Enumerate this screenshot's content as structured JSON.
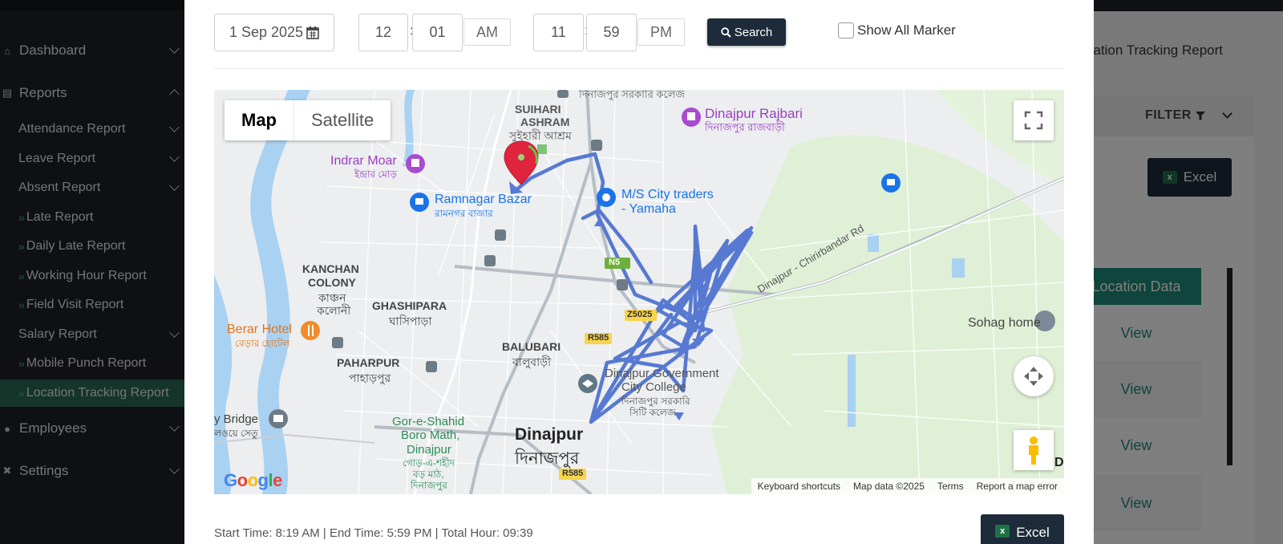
{
  "sidebar": {
    "items": [
      {
        "label": "Dashboard",
        "icon": "home-icon"
      },
      {
        "label": "Reports",
        "icon": "report-icon"
      },
      {
        "label": "Employees",
        "icon": "users-icon"
      },
      {
        "label": "Settings",
        "icon": "tools-icon"
      }
    ],
    "sub_items": [
      {
        "label": "Attendance Report"
      },
      {
        "label": "Leave Report"
      },
      {
        "label": "Absent Report"
      },
      {
        "label": "Late Report"
      },
      {
        "label": "Daily Late Report"
      },
      {
        "label": "Working Hour Report"
      },
      {
        "label": "Field Visit Report"
      },
      {
        "label": "Salary Report"
      },
      {
        "label": "Mobile Punch Report"
      },
      {
        "label": "Location Tracking Report"
      }
    ]
  },
  "background_page": {
    "breadcrumb": "Location Tracking Report",
    "filter_label": "FILTER",
    "excel_label": "Excel",
    "column_header": "Location Data",
    "row_action": "View"
  },
  "modal": {
    "date": "1 Sep 2025",
    "start_hour": "12",
    "start_minute": "01",
    "start_ampm": "AM",
    "end_hour": "11",
    "end_minute": "59",
    "end_ampm": "PM",
    "colon": ":",
    "search_label": "Search",
    "show_all_marker_label": "Show All Marker",
    "summary": "Start Time: 8:19 AM | End Time: 5:59 PM | Total Hour: 09:39",
    "excel_label": "Excel"
  },
  "map": {
    "type_map": "Map",
    "type_satellite": "Satellite",
    "attribution": {
      "shortcuts": "Keyboard shortcuts",
      "data": "Map data ©2025",
      "terms": "Terms",
      "report": "Report a map error"
    },
    "google": "Google",
    "labels": {
      "suihari": "SUIHARI",
      "ashram": "ASHRAM",
      "suihari_bn": "সুইহারী আশ্রম",
      "college_bn": "দিনাজপুর সরকারি কলেজ",
      "rajbari": "Dinajpur Rajbari",
      "rajbari_bn": "দিনাজপুর রাজবাড়ী",
      "indrar": "Indrar Moar",
      "indrar_bn": "ইন্দ্রার মোড়",
      "ramnagar": "Ramnagar Bazar",
      "ramnagar_bn": "রামনগর বাজার",
      "city_traders": "M/S City traders",
      "yamaha": "- Yamaha",
      "kanchan": "KANCHAN",
      "colony": "COLONY",
      "kanchan_bn": "কাঞ্চন",
      "colony_bn": "কলোনী",
      "ghashipara": "GHASHIPARA",
      "ghashipara_bn": "ঘাসিপাড়া",
      "berar": "Berar Hotel",
      "berar_bn": "বেড়ার হোটেল",
      "paharpur": "PAHARPUR",
      "paharpur_bn": "পাহাড়পুর",
      "balubari": "BALUBARI",
      "balubari_bn": "বালুবাড়ী",
      "govt_college_1": "Dinajpur Government",
      "govt_college_2": "City College",
      "govt_college_bn": "দিনাজপুর সরকারি",
      "govt_college_bn2": "সিটি কলেজ",
      "dinajpur": "Dinajpur",
      "dinajpur_bn": "দিনাজপুর",
      "gor_1": "Gor-e-Shahid",
      "gor_2": "Boro Math,",
      "gor_3": "Dinajpur",
      "gor_bn": "গোড়-এ-শহীদ",
      "gor_bn2": "বড় মাঠ,",
      "gor_bn3": "দিনাজপুর",
      "bridge": "y Bridge",
      "bridge_bn": "লওয়ে সেতু",
      "road": "Dinajpur - Chirirbandar Rd",
      "sohag": "Sohag home",
      "n5": "N5",
      "z5025": "Z5025",
      "r585": "R585",
      "r585b": "R585",
      "edge_d": "D"
    }
  },
  "colors": {
    "primary_dark": "#1d2b3a",
    "teal": "#1f8a78",
    "track": "#5779d1",
    "sidebar": "#1c2126"
  }
}
